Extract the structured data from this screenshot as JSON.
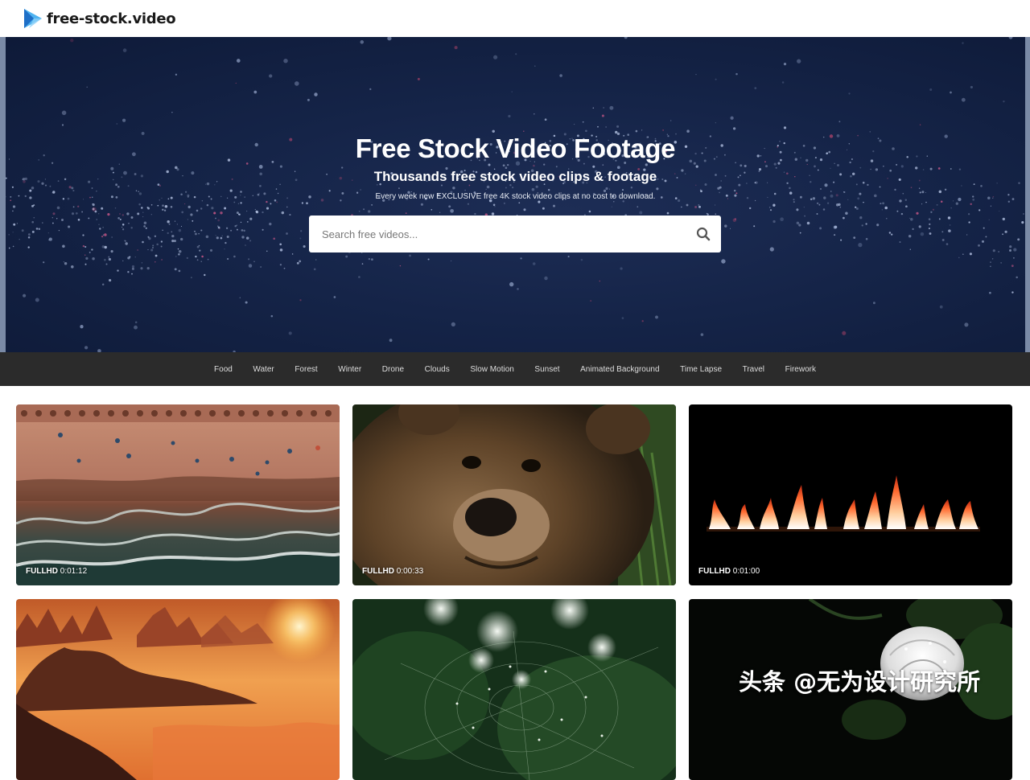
{
  "header": {
    "logo_text": "free-stock.video",
    "logo_icon": "play-triangle-icon"
  },
  "hero": {
    "title": "Free Stock Video Footage",
    "subtitle": "Thousands free stock video clips & footage",
    "note": "Every week new EXCLUSIVE free 4K stock video clips at no cost to download.",
    "search_placeholder": "Search free videos...",
    "search_icon": "search-icon"
  },
  "categories": [
    "Food",
    "Water",
    "Forest",
    "Winter",
    "Drone",
    "Clouds",
    "Slow Motion",
    "Sunset",
    "Animated Background",
    "Time Lapse",
    "Travel",
    "Firework"
  ],
  "videos": [
    {
      "quality": "FULLHD",
      "duration": "0:01:12",
      "subject": "aerial beach"
    },
    {
      "quality": "FULLHD",
      "duration": "0:00:33",
      "subject": "brown bear"
    },
    {
      "quality": "FULLHD",
      "duration": "0:01:00",
      "subject": "fire flames"
    },
    {
      "quality": "",
      "duration": "",
      "subject": "sunset mountains"
    },
    {
      "quality": "",
      "duration": "",
      "subject": "spider web"
    },
    {
      "quality": "",
      "duration": "",
      "subject": "white rose"
    }
  ],
  "watermark": "头条 @无为设计研究所",
  "colors": {
    "hero_bg": "#152448",
    "nav_bg": "#2b2b2b",
    "logo_blue": "#2a8fe0"
  }
}
